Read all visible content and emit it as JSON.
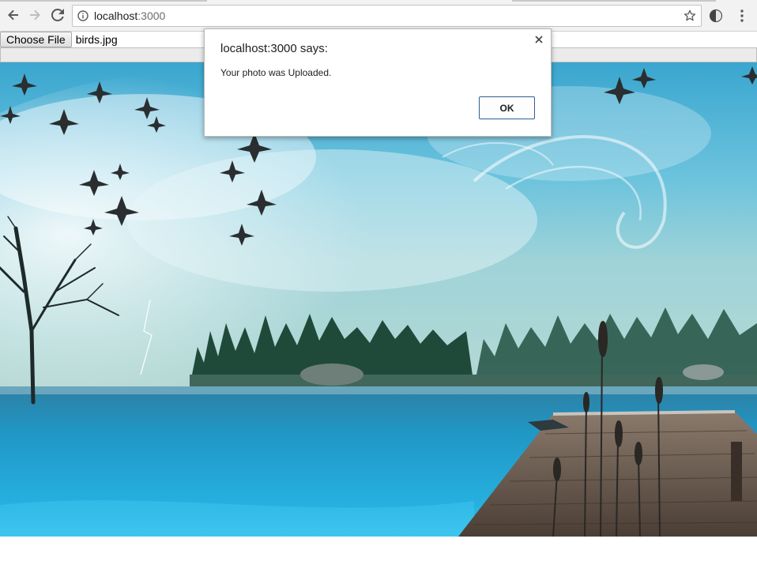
{
  "browser": {
    "url_host": "localhost",
    "url_port": ":3000",
    "icons": {
      "back": "back-arrow-icon",
      "forward": "forward-arrow-icon",
      "reload": "reload-icon",
      "info": "info-icon",
      "star": "bookmark-star-icon",
      "extension": "extension-icon",
      "menu": "kebab-menu-icon"
    }
  },
  "upload": {
    "button_label": "Choose File",
    "file_name": "birds.jpg"
  },
  "dialog": {
    "title": "localhost:3000 says:",
    "message": "Your photo was Uploaded.",
    "ok_label": "OK"
  },
  "colors": {
    "dialog_button_border": "#2f5d9a",
    "sky": "#4fb3d6",
    "water": "#1a8fc0"
  }
}
